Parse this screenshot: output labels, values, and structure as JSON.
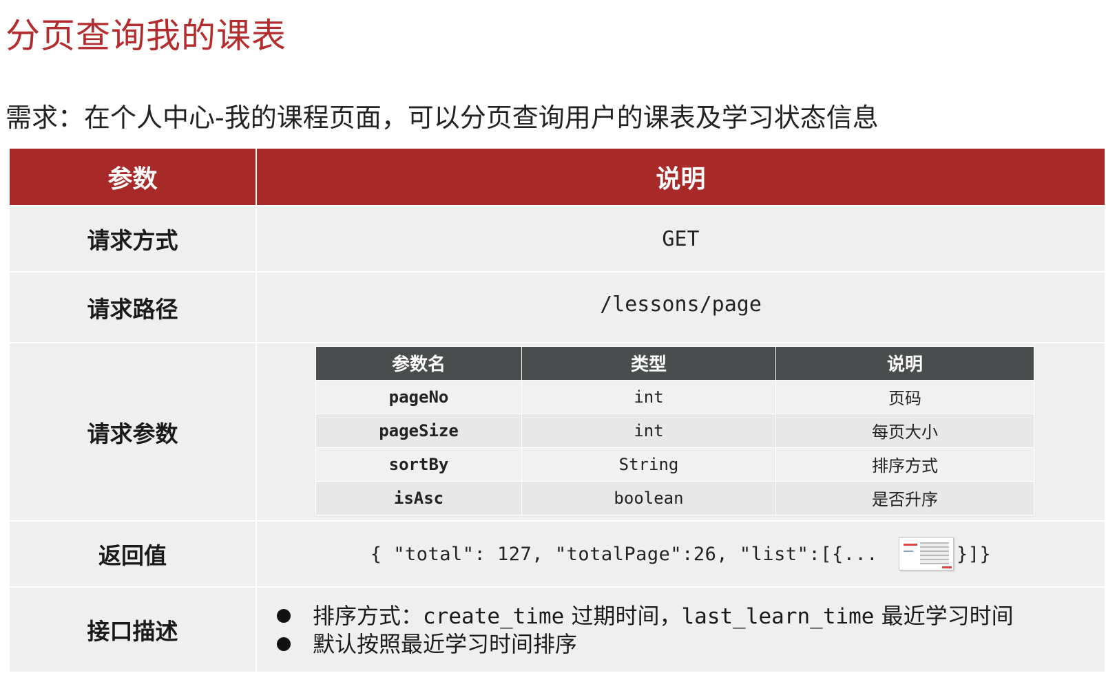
{
  "title": "分页查询我的课表",
  "requirement": "需求：在个人中心-我的课程页面，可以分页查询用户的课表及学习状态信息",
  "table": {
    "headers": [
      "参数",
      "说明"
    ],
    "method": {
      "label": "请求方式",
      "value": "GET"
    },
    "path": {
      "label": "请求路径",
      "value": "/lessons/page"
    },
    "params": {
      "label": "请求参数",
      "headers": [
        "参数名",
        "类型",
        "说明"
      ],
      "rows": [
        {
          "name": "pageNo",
          "type": "int",
          "desc": "页码"
        },
        {
          "name": "pageSize",
          "type": "int",
          "desc": "每页大小"
        },
        {
          "name": "sortBy",
          "type": "String",
          "desc": "排序方式"
        },
        {
          "name": "isAsc",
          "type": "boolean",
          "desc": "是否升序"
        }
      ]
    },
    "return": {
      "label": "返回值",
      "prefix": "{ \"total\": 127, \"totalPage\":26, \"list\":[{...",
      "suffix": "}]}"
    },
    "description": {
      "label": "接口描述",
      "item1": {
        "a": "排序方式：",
        "b": "create_time",
        "c": " 过期时间，",
        "d": "last_learn_time",
        "e": " 最近学习时间"
      },
      "item2": "默认按照最近学习时间排序"
    }
  }
}
